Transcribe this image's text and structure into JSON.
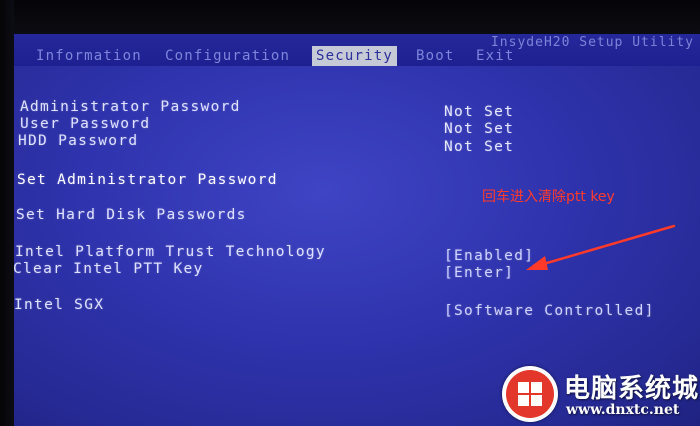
{
  "product_name": "InsydeH20 Setup Utility",
  "tabs": [
    {
      "label": "Information",
      "active": false
    },
    {
      "label": "Configuration",
      "active": false
    },
    {
      "label": "Security",
      "active": true
    },
    {
      "label": "Boot",
      "active": false
    },
    {
      "label": "Exit",
      "active": false
    }
  ],
  "security": {
    "admin_password": {
      "label": "Administrator Password",
      "value": "Not Set"
    },
    "user_password": {
      "label": "User Password",
      "value": "Not Set"
    },
    "hdd_password": {
      "label": "HDD Password",
      "value": "Not Set"
    },
    "set_admin_password": {
      "label": "Set Administrator Password"
    },
    "set_hdd_passwords": {
      "label": "Set Hard Disk Passwords"
    },
    "ptt": {
      "label": "Intel Platform Trust Technology",
      "value": "[Enabled]"
    },
    "clear_ptt": {
      "label": "Clear Intel PTT Key",
      "value": "[Enter]"
    },
    "sgx": {
      "label": "Intel SGX",
      "value": "[Software Controlled]"
    }
  },
  "annotation": {
    "text": "回车进入清除ptt key",
    "color": "#ff3a2a"
  },
  "watermark": {
    "title": "电脑系统城",
    "url": "www.dnxtc.net"
  },
  "colors": {
    "bios_background": "#2f33ad",
    "menubar": "#1d2090",
    "active_tab_bg": "#c6c9d6",
    "text": "#dfe2ff"
  }
}
